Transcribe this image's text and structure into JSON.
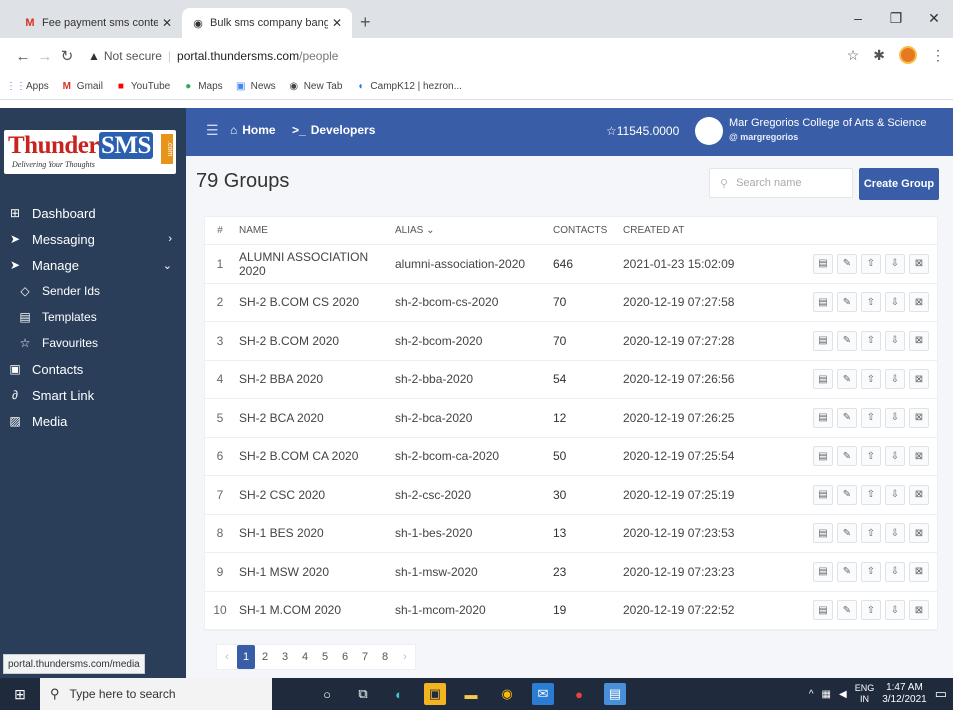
{
  "browser": {
    "tabs": [
      {
        "title": "Fee payment sms content - hen:",
        "icon": "gmail-icon"
      },
      {
        "title": "Bulk sms company bangalore - s",
        "icon": "chrome-icon"
      }
    ],
    "url_security": "Not secure",
    "url_host": "portal.thundersms.com",
    "url_path": "/people",
    "bookmarks": [
      {
        "label": "Apps",
        "icon": "apps-grid-icon"
      },
      {
        "label": "Gmail",
        "icon": "gmail-icon"
      },
      {
        "label": "YouTube",
        "icon": "youtube-icon"
      },
      {
        "label": "Maps",
        "icon": "maps-icon"
      },
      {
        "label": "News",
        "icon": "news-icon"
      },
      {
        "label": "New Tab",
        "icon": "chrome-icon"
      },
      {
        "label": "CampK12 | hezron...",
        "icon": "campk12-icon"
      }
    ],
    "status_url": "portal.thundersms.com/media"
  },
  "logo": {
    "thunder": "Thunder",
    "sms": "SMS",
    "com": ".com",
    "tagline": "Delivering Your Thoughts"
  },
  "sidebar": {
    "items": [
      {
        "label": "Dashboard",
        "icon": "dashboard-icon"
      },
      {
        "label": "Messaging",
        "icon": "send-icon",
        "caret": "›"
      },
      {
        "label": "Manage",
        "icon": "send-icon",
        "caret": "⌄"
      },
      {
        "label": "Sender Ids",
        "icon": "tag-icon"
      },
      {
        "label": "Templates",
        "icon": "template-icon"
      },
      {
        "label": "Favourites",
        "icon": "star-icon"
      },
      {
        "label": "Contacts",
        "icon": "contacts-icon"
      },
      {
        "label": "Smart Link",
        "icon": "link-icon"
      },
      {
        "label": "Media",
        "icon": "media-icon"
      }
    ]
  },
  "topbar": {
    "home": "Home",
    "developers": "Developers",
    "balance": "11545.0000",
    "org_name": "Mar Gregorios College of Arts & Science",
    "org_handle": "@ margregorios"
  },
  "page": {
    "title": "79 Groups",
    "search_placeholder": "Search name",
    "create_label": "Create Group"
  },
  "table": {
    "headers": [
      "#",
      "NAME",
      "ALIAS",
      "CONTACTS",
      "CREATED AT"
    ],
    "rows": [
      {
        "num": "1",
        "name": "ALUMNI ASSOCIATION 2020",
        "alias": "alumni-association-2020",
        "contacts": "646",
        "created": "2021-01-23 15:02:09"
      },
      {
        "num": "2",
        "name": "SH-2 B.COM CS 2020",
        "alias": "sh-2-bcom-cs-2020",
        "contacts": "70",
        "created": "2020-12-19 07:27:58"
      },
      {
        "num": "3",
        "name": "SH-2 B.COM 2020",
        "alias": "sh-2-bcom-2020",
        "contacts": "70",
        "created": "2020-12-19 07:27:28"
      },
      {
        "num": "4",
        "name": "SH-2 BBA 2020",
        "alias": "sh-2-bba-2020",
        "contacts": "54",
        "created": "2020-12-19 07:26:56"
      },
      {
        "num": "5",
        "name": "SH-2 BCA 2020",
        "alias": "sh-2-bca-2020",
        "contacts": "12",
        "created": "2020-12-19 07:26:25"
      },
      {
        "num": "6",
        "name": "SH-2 B.COM CA 2020",
        "alias": "sh-2-bcom-ca-2020",
        "contacts": "50",
        "created": "2020-12-19 07:25:54"
      },
      {
        "num": "7",
        "name": "SH-2 CSC 2020",
        "alias": "sh-2-csc-2020",
        "contacts": "30",
        "created": "2020-12-19 07:25:19"
      },
      {
        "num": "8",
        "name": "SH-1 BES 2020",
        "alias": "sh-1-bes-2020",
        "contacts": "13",
        "created": "2020-12-19 07:23:53"
      },
      {
        "num": "9",
        "name": "SH-1 MSW 2020",
        "alias": "sh-1-msw-2020",
        "contacts": "23",
        "created": "2020-12-19 07:23:23"
      },
      {
        "num": "10",
        "name": "SH-1 M.COM 2020",
        "alias": "sh-1-mcom-2020",
        "contacts": "19",
        "created": "2020-12-19 07:22:52"
      }
    ],
    "row_actions": [
      "view-icon",
      "edit-icon",
      "upload-icon",
      "download-icon",
      "delete-icon"
    ]
  },
  "pagination": {
    "prev": "‹",
    "pages": [
      "1",
      "2",
      "3",
      "4",
      "5",
      "6",
      "7",
      "8"
    ],
    "next": "›",
    "current": "1"
  },
  "taskbar": {
    "search_placeholder": "Type here to search",
    "lang_top": "ENG",
    "lang_bottom": "IN",
    "time": "1:47 AM",
    "date": "3/12/2021"
  },
  "colors": {
    "sidebar": "#2a3e5a",
    "topbar": "#3a5da8",
    "accent": "#3a5da8",
    "logo_red": "#c8231f"
  }
}
